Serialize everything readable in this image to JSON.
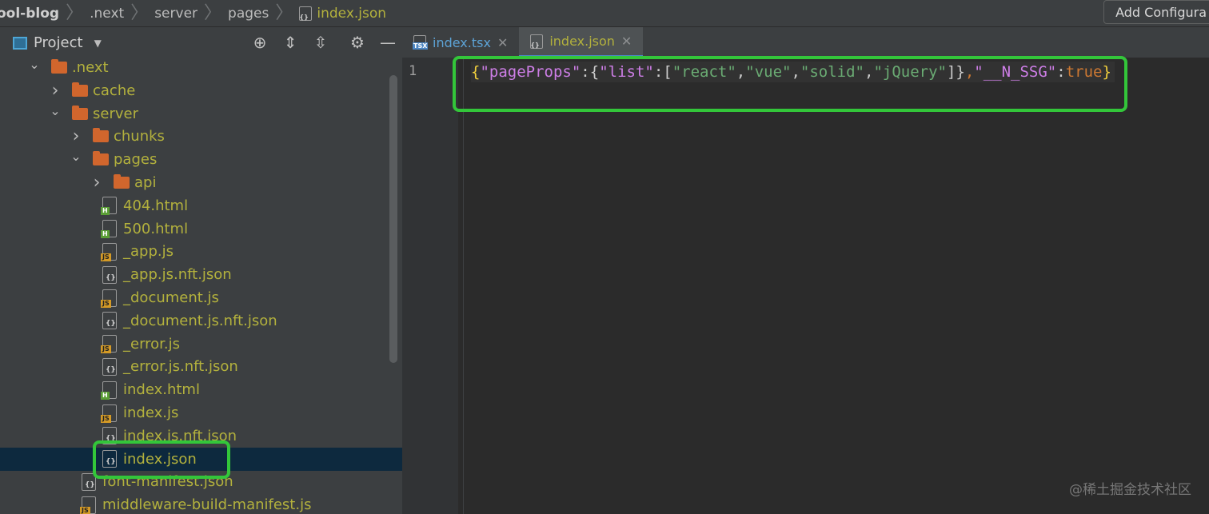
{
  "breadcrumb": [
    "ool-blog",
    ".next",
    "server",
    "pages",
    "index.json"
  ],
  "toolbar": {
    "add_config_label": "Add Configura"
  },
  "project_panel": {
    "title": "Project",
    "tools": [
      "locate-icon",
      "expand-all-icon",
      "collapse-all-icon",
      "gear-icon",
      "minimize-icon"
    ],
    "tree": [
      {
        "label": ".next",
        "kind": "folder",
        "expanded": true,
        "depth": 1
      },
      {
        "label": "cache",
        "kind": "folder",
        "expanded": false,
        "depth": 2
      },
      {
        "label": "server",
        "kind": "folder",
        "expanded": true,
        "depth": 2
      },
      {
        "label": "chunks",
        "kind": "folder",
        "expanded": false,
        "depth": 3
      },
      {
        "label": "pages",
        "kind": "folder",
        "expanded": true,
        "depth": 3
      },
      {
        "label": "api",
        "kind": "folder",
        "expanded": false,
        "depth": 4
      },
      {
        "label": "404.html",
        "kind": "html",
        "depth": 4
      },
      {
        "label": "500.html",
        "kind": "html",
        "depth": 4
      },
      {
        "label": "_app.js",
        "kind": "js",
        "depth": 4
      },
      {
        "label": "_app.js.nft.json",
        "kind": "json",
        "depth": 4
      },
      {
        "label": "_document.js",
        "kind": "js",
        "depth": 4
      },
      {
        "label": "_document.js.nft.json",
        "kind": "json",
        "depth": 4
      },
      {
        "label": "_error.js",
        "kind": "js",
        "depth": 4
      },
      {
        "label": "_error.js.nft.json",
        "kind": "json",
        "depth": 4
      },
      {
        "label": "index.html",
        "kind": "html",
        "depth": 4
      },
      {
        "label": "index.js",
        "kind": "js",
        "depth": 4
      },
      {
        "label": "index.js.nft.json",
        "kind": "json",
        "depth": 4
      },
      {
        "label": "index.json",
        "kind": "json",
        "depth": 4,
        "selected": true
      },
      {
        "label": "font-manifest.json",
        "kind": "json",
        "depth": 3
      },
      {
        "label": "middleware-build-manifest.js",
        "kind": "bin",
        "depth": 3
      }
    ]
  },
  "editor": {
    "tabs": [
      {
        "label": "index.tsx",
        "icon_text": "TSX",
        "active": false
      },
      {
        "label": "index.json",
        "icon_text": "{}",
        "active": true
      }
    ],
    "line_number": "1",
    "code": {
      "open": "{",
      "k1": "\"pageProps\"",
      "c1": ":{",
      "k2": "\"list\"",
      "c2": ":[",
      "v1": "\"react\"",
      "s1": ",",
      "v2": "\"vue\"",
      "s2": ",",
      "v3": "\"solid\"",
      "s3": ",",
      "v4": "\"jQuery\"",
      "c3": "]}",
      "s4": ",",
      "k3": "\"__N_SSG\"",
      "c4": ":",
      "v5": "true",
      "close": "}"
    }
  },
  "watermark": "@稀土掘金技术社区",
  "colors": {
    "highlight": "#33c63a",
    "selection": "#0d293e",
    "folder": "#d1662d"
  }
}
